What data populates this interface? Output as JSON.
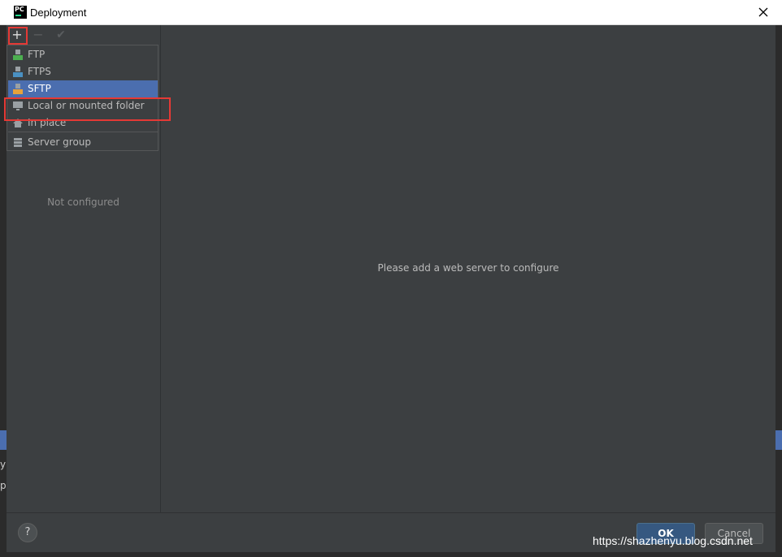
{
  "window": {
    "title": "Deployment",
    "app_icon_text": "PC"
  },
  "toolbar": {
    "add": "+",
    "remove": "−",
    "apply": "✔"
  },
  "popup": {
    "items": [
      {
        "label": "FTP",
        "icon": "ftp-icon",
        "badge": "FTP",
        "badge_color": "#4caf50"
      },
      {
        "label": "FTPS",
        "icon": "ftps-icon",
        "badge": "FTPS",
        "badge_color": "#4a90c2"
      },
      {
        "label": "SFTP",
        "icon": "sftp-icon",
        "badge": "SFTP",
        "badge_color": "#e6a23c",
        "selected": true
      },
      {
        "label": "Local or mounted folder",
        "icon": "folder-icon"
      },
      {
        "label": "In place",
        "icon": "home-icon"
      },
      {
        "label": "Server group",
        "icon": "server-group-icon"
      }
    ]
  },
  "left_panel": {
    "empty_text": "Not configured"
  },
  "main": {
    "message": "Please add a web server to configure"
  },
  "footer": {
    "help": "?",
    "ok": "OK",
    "cancel": "Cancel"
  },
  "watermark": "https://shazhenyu.blog.csdn.net",
  "background": {
    "text1": "y",
    "text2": "p"
  },
  "colors": {
    "selection": "#4b6eaf",
    "highlight_border": "#e53935",
    "panel": "#3c3f41"
  }
}
